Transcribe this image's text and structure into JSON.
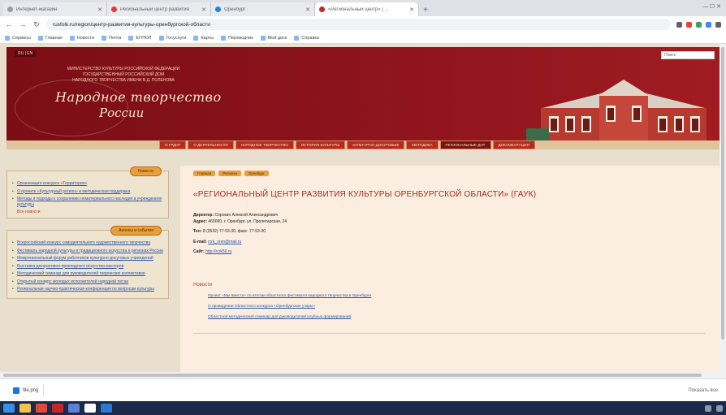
{
  "browser": {
    "tabs": [
      {
        "label": "Интернет-магазин",
        "active": false
      },
      {
        "label": "Региональный центр развития",
        "active": false
      },
      {
        "label": "Оренбург",
        "active": false
      },
      {
        "label": "«Региональный центр» | ...",
        "active": true
      }
    ],
    "new_tab": "+",
    "window_controls": "— ☐ ✕",
    "back": "←",
    "forward": "→",
    "reload": "↻",
    "address": "rusfolk.ru/region/центр-развития-культуры-оренбургской-области",
    "bookmarks": [
      "Сервисы",
      "Главная",
      "Новости",
      "Почта",
      "ЕГРЮЛ",
      "Госуслуги",
      "Карты",
      "Переводчик",
      "Мой диск",
      "Справка"
    ]
  },
  "site": {
    "lang": "RU | EN",
    "search_placeholder": "Поиск",
    "ministry_line1": "МИНИСТЕРСТВО КУЛЬТУРЫ РОССИЙСКОЙ ФЕДЕРАЦИИ",
    "ministry_line2": "ГОСУДАРСТВЕННЫЙ РОССИЙСКИЙ ДОМ",
    "ministry_line3": "НАРОДНОГО ТВОРЧЕСТВА ИМЕНИ В.Д. ПОЛЕНОВА",
    "logo_line1": "Народное творчество",
    "logo_line2": "России",
    "nav": [
      {
        "label": "О ГРДНТ",
        "selected": false
      },
      {
        "label": "О ДЕЯТЕЛЬНОСТИ",
        "selected": false
      },
      {
        "label": "НАРОДНОЕ ТВОРЧЕСТВО",
        "selected": false
      },
      {
        "label": "ИСТОРИЯ КУЛЬТУРЫ",
        "selected": false
      },
      {
        "label": "КУЛЬТУРНО-ДОСУГОВЫЕ",
        "selected": false
      },
      {
        "label": "МЕТОДИКА",
        "selected": false
      },
      {
        "label": "РЕГИОНАЛЬНЫЕ ДНТ",
        "selected": true
      },
      {
        "label": "ДОКУМЕНТАЦИЯ",
        "selected": false
      }
    ]
  },
  "sidebar": {
    "box1_button": "Новости",
    "box1_items": [
      "Организация конкурса «Территория»",
      "О проекте «Культурный регион» и методическая поддержка",
      "Методы и подходы к сохранению нематериального наследия в учреждениях культуры"
    ],
    "box1_more": "Все новости",
    "box2_button": "Анонсы и события",
    "box2_items": [
      "Всероссийский конкурс самодеятельного художественного творчества",
      "Фестиваль народной культуры и традиционного искусства в регионах России",
      "Межрегиональный форум работников культурно-досуговых учреждений",
      "Выставка декоративно-прикладного искусства мастеров",
      "Методический семинар для руководителей творческих коллективов",
      "Открытый конкурс молодых исполнителей народной песни",
      "Региональная научно-практическая конференция по вопросам культуры"
    ]
  },
  "content": {
    "crumbs": [
      "Главная",
      "Регионы",
      "Оренбург"
    ],
    "title": "«РЕГИОНАЛЬНЫЙ ЦЕНТР РАЗВИТИЯ КУЛЬТУРЫ ОРЕНБУРГСКОЙ ОБЛАСТИ» (ГАУК)",
    "director_label": "Директор:",
    "director": "Сорокин Алексей Александрович",
    "address_label": "Адрес:",
    "address": "460000, г. Оренбург, ул. Пролетарская, 24",
    "phone_label": "Тел:",
    "phone": "8 (3532) 77-53-30, факс: 77-53-30",
    "email_label": "E-mail:",
    "email": "rcrk_oren@mail.ru",
    "site_label": "Сайт:",
    "site": "http://rcrk56.ru",
    "news_header": "Новости",
    "news": [
      "Проект «Мы вместе» по итогам областного фестиваля народного творчества в Оренбурге",
      "О проведении Областного конкурса «Оренбургские узоры»",
      "Областной методический семинар для руководителей клубных формирований"
    ]
  },
  "downloads": {
    "item": "file.png",
    "show_all": "Показать все"
  },
  "colors": {
    "brand_red": "#8e141d",
    "link": "#2a55a8",
    "accent_orange": "#e9a03a"
  }
}
